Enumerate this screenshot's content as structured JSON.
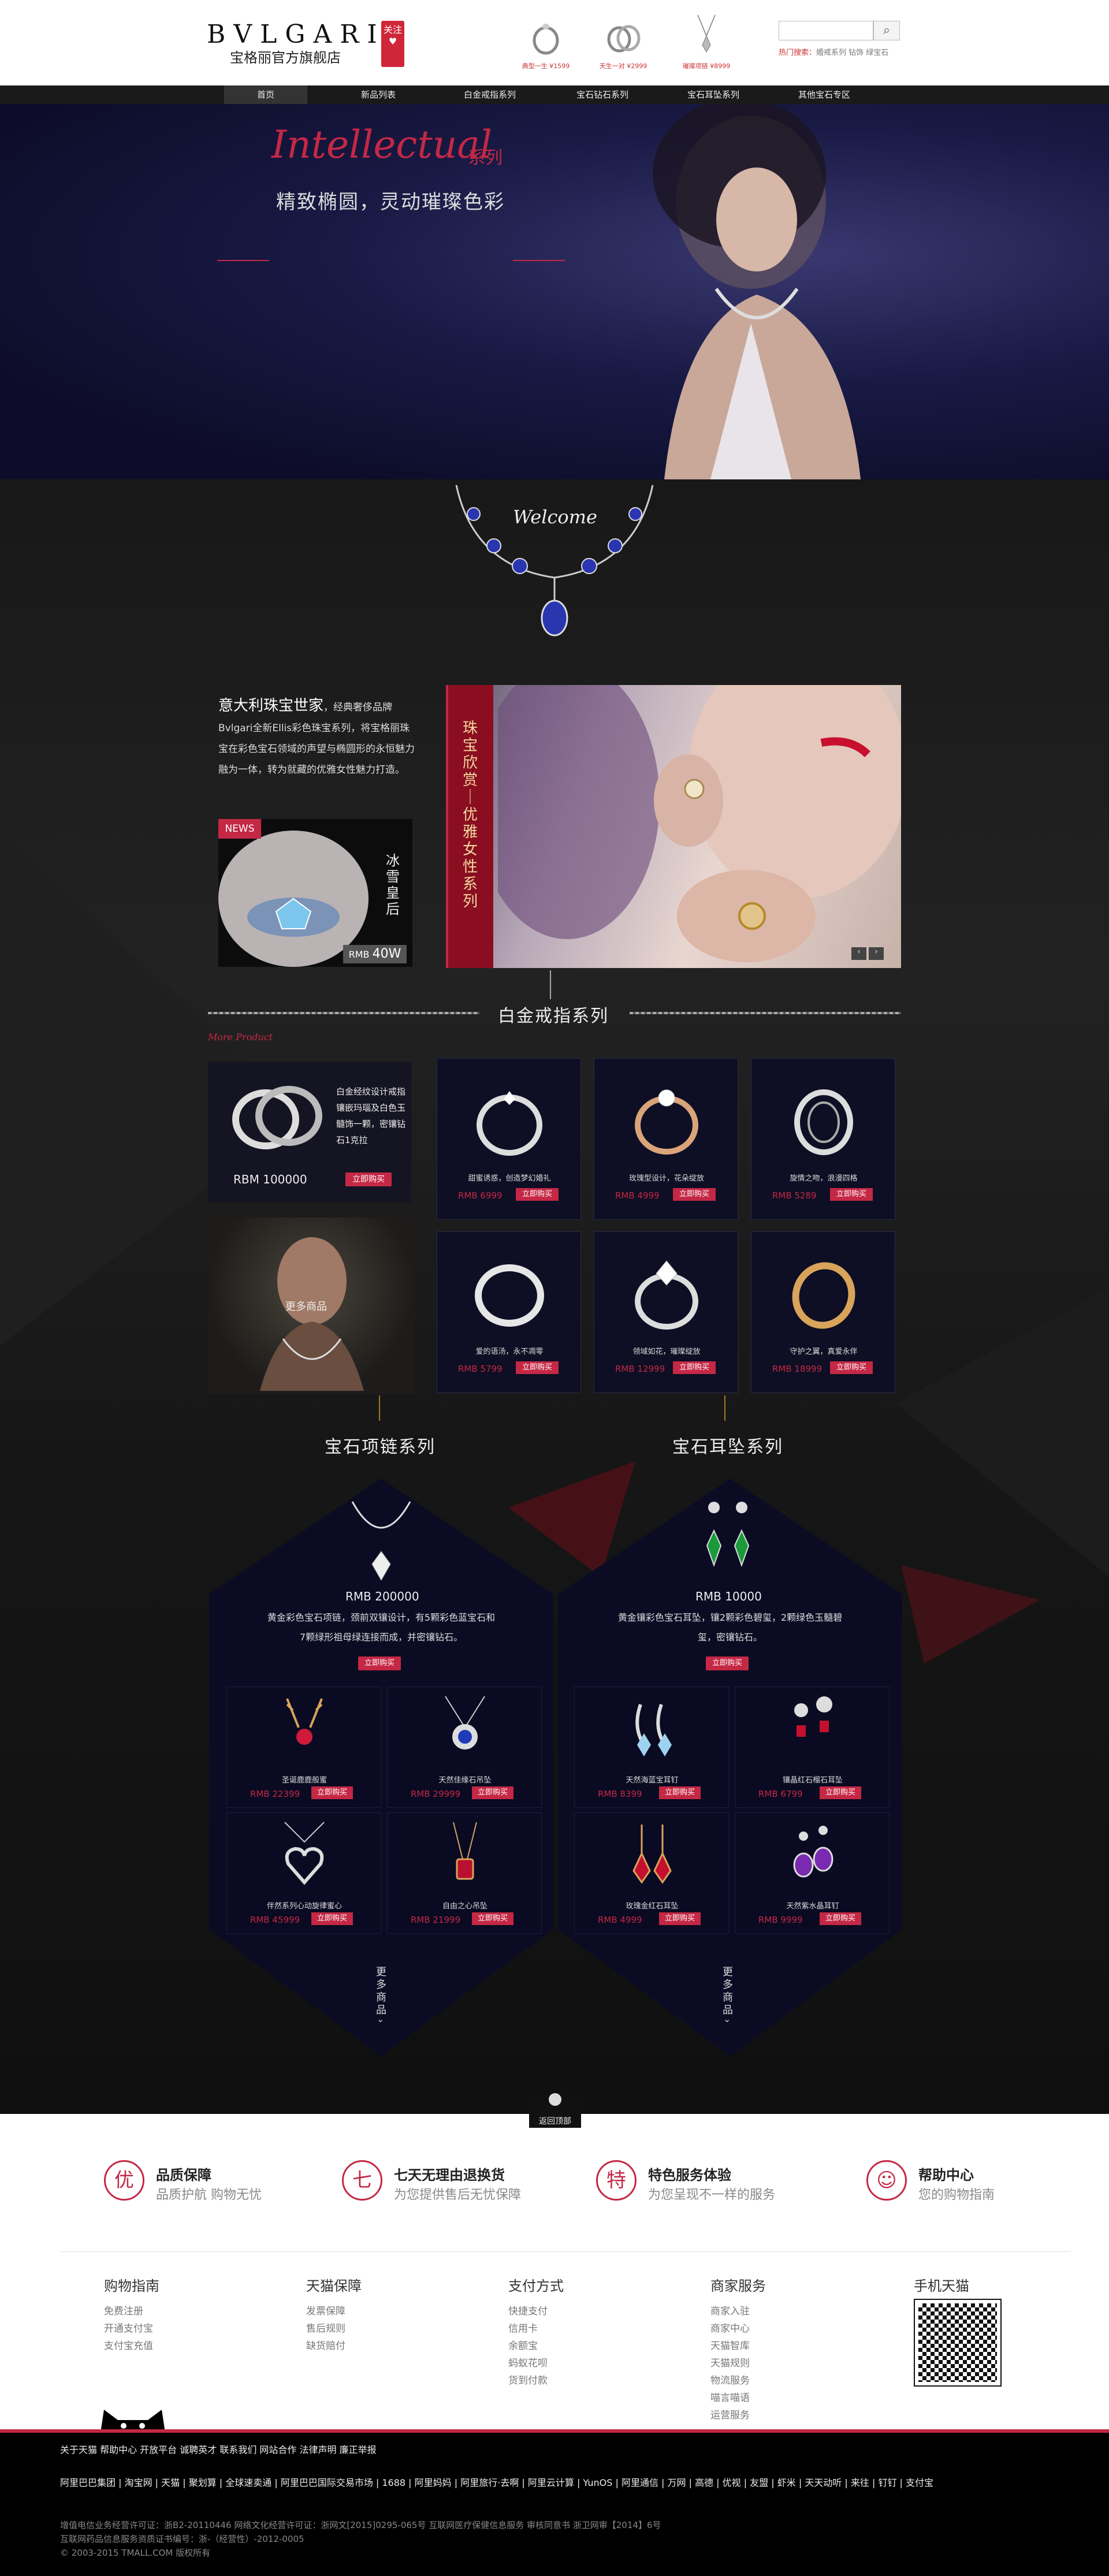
{
  "header": {
    "logo": "BVLGARI",
    "store_name": "宝格丽官方旗舰店",
    "follow": "关注",
    "products": [
      {
        "caption": "典型一生 ¥1599"
      },
      {
        "caption": "天生一对 ¥2999"
      },
      {
        "caption": "璀璨项链 ¥8999"
      }
    ],
    "search_placeholder": "",
    "hot_label": "热门搜索：",
    "hot_terms": "婚戒系列  钻饰  绿宝石"
  },
  "nav": {
    "items": [
      "首页",
      "新品列表",
      "白金戒指系列",
      "宝石钻石系列",
      "宝石耳坠系列",
      "其他宝石专区"
    ]
  },
  "hero": {
    "script_title": "Intellectual",
    "series_word": "系列",
    "subtitle": "精致椭圆，灵动璀璨色彩"
  },
  "welcome": "Welcome",
  "intro": {
    "title": "意大利珠宝世家",
    "body": "，经典奢侈品牌Bvlgari全新Ellis彩色珠宝系列，将宝格丽珠宝在彩色宝石领域的声望与椭圆形的永恒魅力融为一体，转为就藏的优雅女性魅力打造。"
  },
  "promo": {
    "news": "NEWS",
    "title": "冰雪皇后",
    "rmb": "RMB",
    "price": "40W"
  },
  "feature": {
    "strip_text": "珠宝欣赏｜优雅女性系列"
  },
  "ring_section": {
    "title": "白金戒指系列",
    "more_script": "More Product",
    "feature_desc": "白金经纹设计戒指镶嵌玛瑙及白色玉髓饰一颗，密镶钻石1克拉",
    "feature_price": "RBM 100000",
    "feature_buy": "立即购买",
    "more_goods": "更多商品",
    "items": [
      {
        "desc": "甜蜜诱惑，创造梦幻婚礼",
        "price": "RMB 6999",
        "buy": "立即购买"
      },
      {
        "desc": "玫瑰型设计，花朵绽放",
        "price": "RMB 4999",
        "buy": "立即购买"
      },
      {
        "desc": "旋情之吻，浪漫四格",
        "price": "RMB 5289",
        "buy": "立即购买"
      },
      {
        "desc": "爱的语汤，永不凋零",
        "price": "RMB 5799",
        "buy": "立即购买"
      },
      {
        "desc": "领域如花，璀璨绽放",
        "price": "RMB 12999",
        "buy": "立即购买"
      },
      {
        "desc": "守护之翼，真爱永伴",
        "price": "RMB 18999",
        "buy": "立即购买"
      }
    ]
  },
  "necklace_section": {
    "title": "宝石项链系列",
    "price": "RMB 200000",
    "desc": "黄金彩色宝石项链，颈前双镶设计，有5颗彩色蓝宝石和7颗绿形祖母绿连接而成，并密镶钻石。",
    "buy": "立即购买",
    "more": "更多商品",
    "items": [
      {
        "desc": "圣诞鹿鹿般蜜",
        "price": "RMB 22399",
        "buy": "立即购买"
      },
      {
        "desc": "天然佳缘石吊坠",
        "price": "RMB 29999",
        "buy": "立即购买"
      },
      {
        "desc": "伴然系列心动旋律蜜心",
        "price": "RMB 45999",
        "buy": "立即购买"
      },
      {
        "desc": "自由之心吊坠",
        "price": "RMB 21999",
        "buy": "立即购买"
      }
    ]
  },
  "earring_section": {
    "title": "宝石耳坠系列",
    "price": "RMB 10000",
    "desc": "黄金镶彩色宝石耳坠，镶2颗彩色碧玺，2颗绿色玉髓碧玺，密镶钻石。",
    "buy": "立即购买",
    "more": "更多商品",
    "items": [
      {
        "desc": "天然海蓝宝耳钉",
        "price": "RMB 8399",
        "buy": "立即购买"
      },
      {
        "desc": "镶晶红石榴石耳坠",
        "price": "RMB 6799",
        "buy": "立即购买"
      },
      {
        "desc": "玫瑰金红石耳坠",
        "price": "RMB 4999",
        "buy": "立即购买"
      },
      {
        "desc": "天然紫水晶耳钉",
        "price": "RMB 9999",
        "buy": "立即购买"
      }
    ]
  },
  "back_to_top": "返回顶部",
  "guarantees": [
    {
      "icon": "优",
      "title": "品质保障",
      "sub": "品质护航 购物无忧"
    },
    {
      "icon": "七",
      "title": "七天无理由退换货",
      "sub": "为您提供售后无忧保障"
    },
    {
      "icon": "特",
      "title": "特色服务体验",
      "sub": "为您呈现不一样的服务"
    },
    {
      "icon": "帮",
      "title": "帮助中心",
      "sub": "您的购物指南"
    }
  ],
  "footer_cols": [
    {
      "head": "购物指南",
      "links": [
        "免费注册",
        "开通支付宝",
        "支付宝充值"
      ]
    },
    {
      "head": "天猫保障",
      "links": [
        "发票保障",
        "售后规则",
        "缺货赔付"
      ]
    },
    {
      "head": "支付方式",
      "links": [
        "快捷支付",
        "信用卡",
        "余额宝",
        "蚂蚁花呗",
        "货到付款"
      ]
    },
    {
      "head": "商家服务",
      "links": [
        "商家入驻",
        "商家中心",
        "天猫智库",
        "天猫规则",
        "物流服务",
        "喵言喵语",
        "运营服务"
      ]
    },
    {
      "head": "手机天猫",
      "links": []
    }
  ],
  "footer_bar": {
    "links": "关于天猫  帮助中心  开放平台  诚聘英才  联系我们  网站合作  法律声明  廉正举报",
    "partners": "阿里巴巴集团 | 淘宝网 | 天猫 | 聚划算 | 全球速卖通 | 阿里巴巴国际交易市场 | 1688 | 阿里妈妈 | 阿里旅行·去啊 | 阿里云计算 | YunOS | 阿里通信 | 万网 | 高德 | 优视 | 友盟 | 虾米 | 天天动听 | 来往 | 钉钉 | 支付宝",
    "license1": "增值电信业务经营许可证：浙B2-20110446          网络文化经营许可证：浙网文[2015]0295-065号          互联网医疗保健信息服务 审核同意书 浙卫网审【2014】6号",
    "license2": "互联网药品信息服务资质证书编号：浙-（经营性）-2012-0005",
    "copyright": "© 2003-2015 TMALL.COM 版权所有"
  }
}
